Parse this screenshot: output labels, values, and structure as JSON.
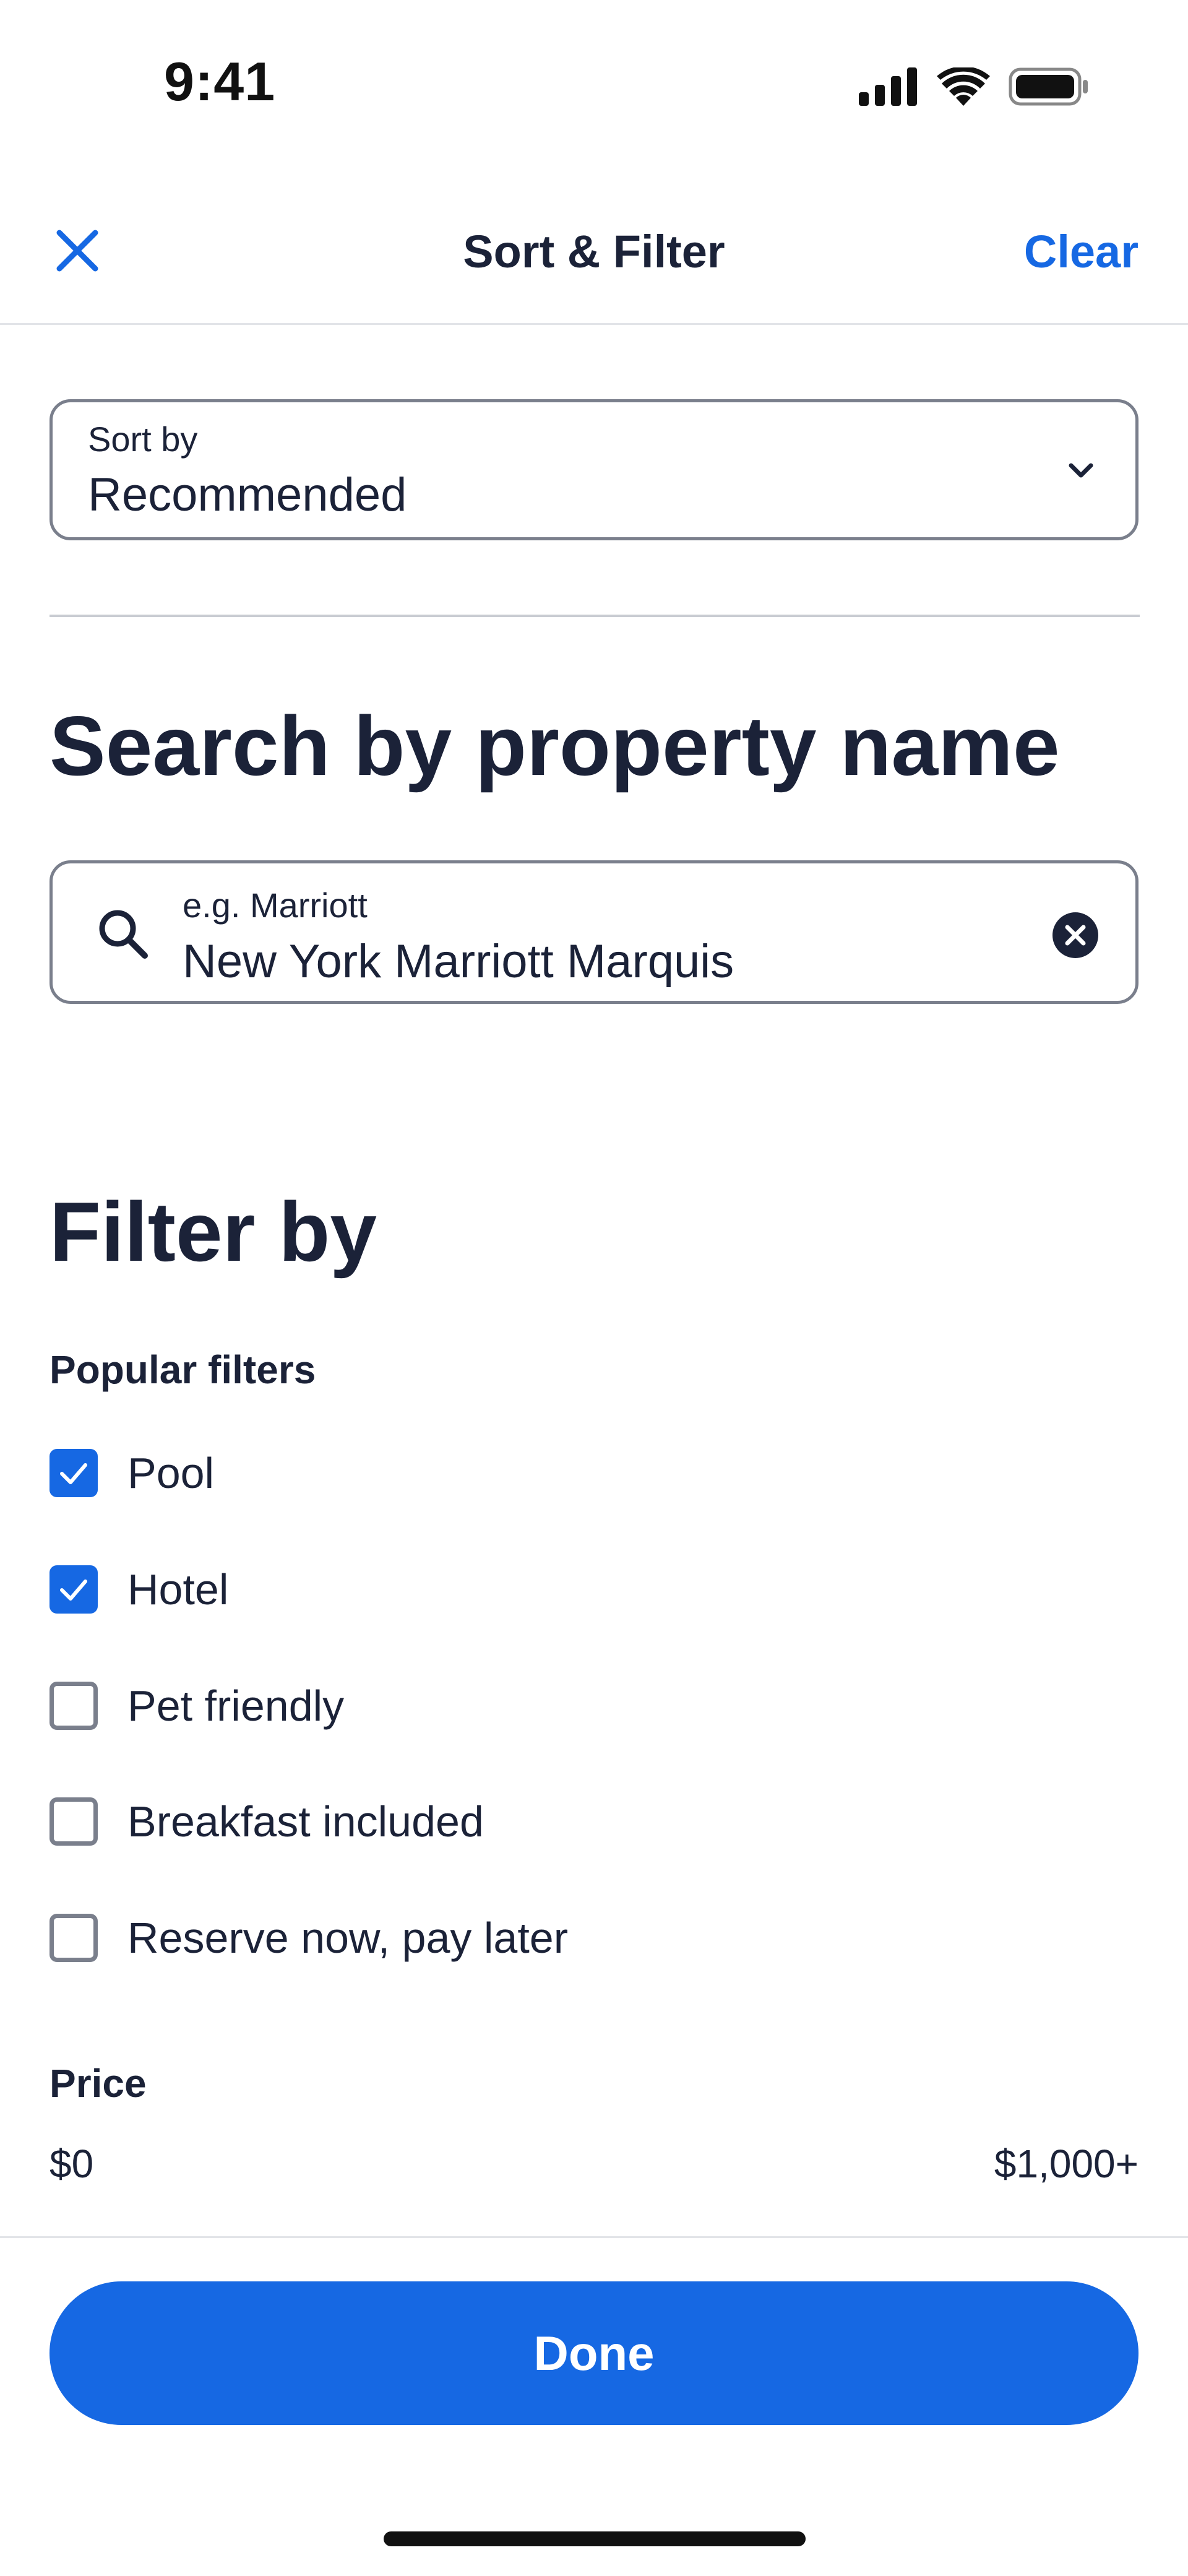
{
  "status_bar": {
    "time": "9:41",
    "icons": [
      "cellular-signal-icon",
      "wifi-icon",
      "battery-icon"
    ]
  },
  "header": {
    "close_icon": "close-icon",
    "title": "Sort & Filter",
    "clear_label": "Clear"
  },
  "sort": {
    "label": "Sort by",
    "value": "Recommended",
    "icon": "chevron-down-icon"
  },
  "search": {
    "title": "Search by property name",
    "placeholder": "e.g. Marriott",
    "value": "New York Marriott Marquis",
    "icon": "search-icon",
    "clear_icon": "clear-input-icon"
  },
  "filter": {
    "title": "Filter by",
    "popular_label": "Popular filters",
    "options": [
      {
        "label": "Pool",
        "checked": true
      },
      {
        "label": "Hotel",
        "checked": true
      },
      {
        "label": "Pet friendly",
        "checked": false
      },
      {
        "label": "Breakfast included",
        "checked": false
      },
      {
        "label": "Reserve now, pay later",
        "checked": false
      }
    ],
    "price": {
      "label": "Price",
      "min": "$0",
      "max": "$1,000+"
    }
  },
  "footer": {
    "done_label": "Done"
  },
  "colors": {
    "accent": "#1668e3",
    "text": "#1b2238",
    "border": "#7a7f8c"
  }
}
